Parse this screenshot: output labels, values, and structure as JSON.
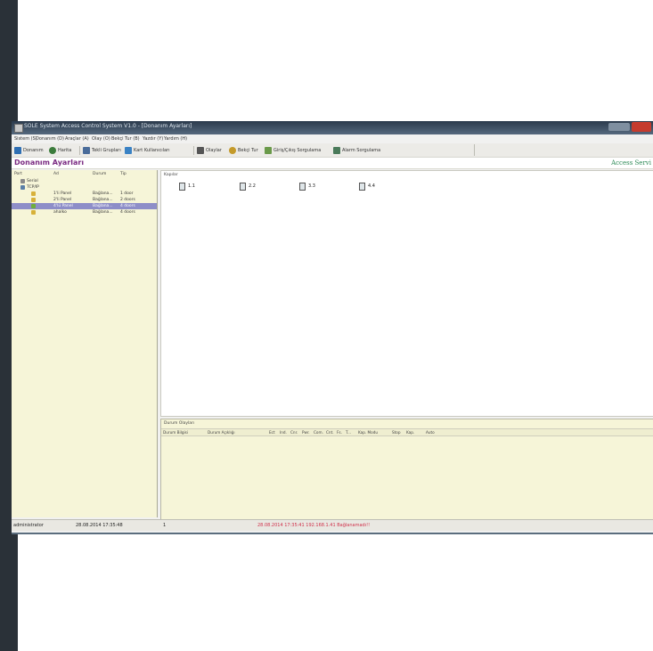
{
  "window": {
    "title": "SOLE System Access Control System V1.0 - [Donanım Ayarları]"
  },
  "menu": [
    "Sistem (S)",
    "Donanım (D)",
    "Araçlar (A)",
    "Olay (O)",
    "Bekçi Tur (B)",
    "Yazdır (Y)",
    "Yardım (H)"
  ],
  "toolbar": {
    "items": [
      {
        "label": "Donanım",
        "icon": "hardware-icon",
        "color": "#2f6fb3"
      },
      {
        "label": "Harita",
        "icon": "map-icon",
        "color": "#3c7c3c"
      },
      {
        "label": "Tekli Grupları",
        "icon": "group-icon",
        "color": "#4a6c9a"
      },
      {
        "label": "Kart Kullanıcıları",
        "icon": "card-users-icon",
        "color": "#3a82c4"
      },
      {
        "label": "Olaylar",
        "icon": "events-icon",
        "color": "#555555"
      },
      {
        "label": "Bekçi Tur",
        "icon": "patrol-icon",
        "color": "#c49a2a"
      },
      {
        "label": "Giriş/Çıkış Sorgulama",
        "icon": "inout-query-icon",
        "color": "#6a9a4a"
      },
      {
        "label": "Alarm Sorgulama",
        "icon": "alarm-query-icon",
        "color": "#4a7a5a"
      }
    ]
  },
  "page": {
    "title": "Donanım Ayarları",
    "brand": "Access Servi"
  },
  "tree": {
    "headers": [
      "Port",
      "Ad",
      "Durum",
      "Tip"
    ],
    "rows": [
      {
        "ad": "Serial",
        "durum": "",
        "tip": "",
        "indent": 1,
        "selected": false,
        "icon": "serial-port-icon"
      },
      {
        "ad": "TCP/IP",
        "durum": "",
        "tip": "",
        "indent": 1,
        "selected": false,
        "icon": "network-icon"
      },
      {
        "ad": "1'li Panel",
        "durum": "Bağlana...",
        "tip": "1 door",
        "indent": 2,
        "selected": false,
        "icon": "door-panel-icon"
      },
      {
        "ad": "2'li Panel",
        "durum": "Bağlana...",
        "tip": "2 doors",
        "indent": 2,
        "selected": false,
        "icon": "door-panel-icon"
      },
      {
        "ad": "4'lü Panel",
        "durum": "Bağlana...",
        "tip": "4 doors",
        "indent": 2,
        "selected": true,
        "icon": "door-panel-icon"
      },
      {
        "ad": "ahalko",
        "durum": "Bağlana...",
        "tip": "4 doors",
        "indent": 2,
        "selected": false,
        "icon": "door-panel-icon"
      }
    ]
  },
  "doors": {
    "label": "Kapılar",
    "items": [
      "1.1",
      "2.2",
      "3.3",
      "4.4"
    ]
  },
  "events": {
    "label": "Durum Olayları",
    "columns": [
      "Durum Bilgisi",
      "Durum Açıklığı",
      "Ect",
      "Ind.",
      "Cnr.",
      "Pwr.",
      "Com.",
      "Cnt.",
      "Fs.",
      "T...",
      "Kap. Modu",
      "Stop",
      "Kap.",
      "Auto"
    ]
  },
  "status": {
    "user": "administrator",
    "datetime": "28.08.2014 17:35:48",
    "count": "1",
    "message": "28.08.2014 17:35:41 192.168.1.41 Bağlanamadı!!",
    "message_color": "#d0304a"
  }
}
